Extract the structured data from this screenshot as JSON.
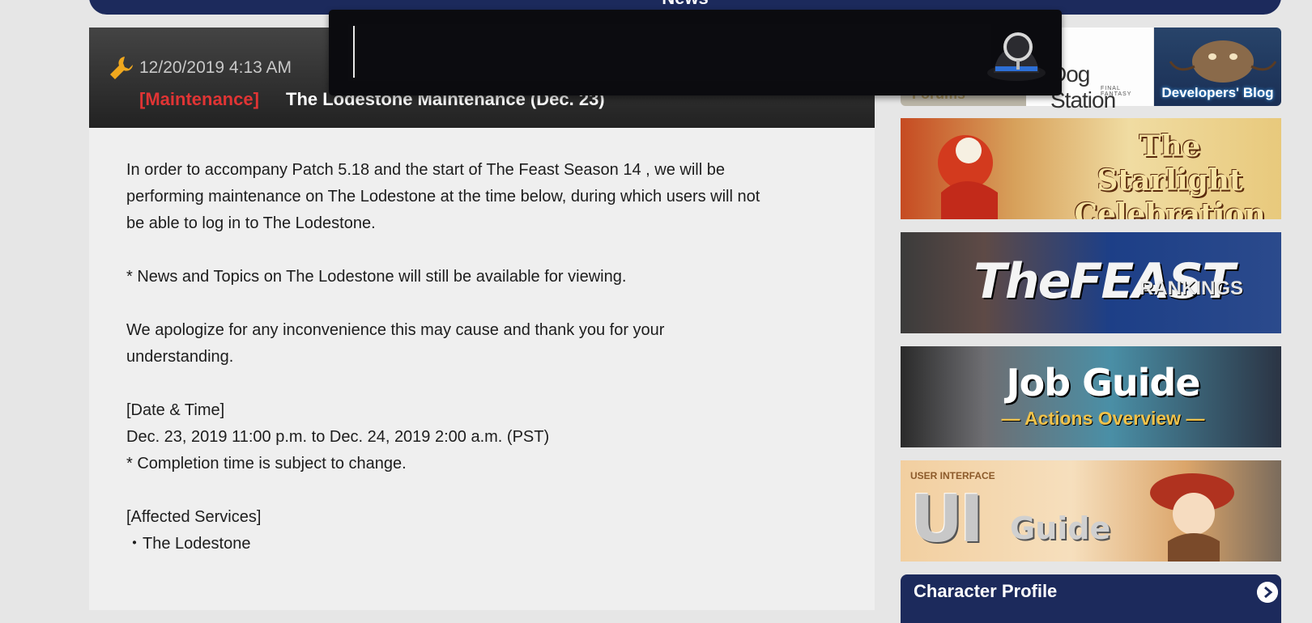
{
  "header": {
    "section_title": "News"
  },
  "article": {
    "date": "12/20/2019 4:13 AM",
    "tag": "[Maintenance]",
    "title": "The Lodestone Maintenance (Dec. 23)",
    "paragraphs": [
      [
        "In order to accompany Patch 5.18 and the start of The Feast Season 14 , we will be",
        "performing maintenance on The Lodestone at the time below, during which users will not",
        "be able to log in to The Lodestone."
      ],
      [
        "* News and Topics on The Lodestone will still be available for viewing."
      ],
      [
        "We apologize for any inconvenience this may cause and thank you for your",
        "understanding."
      ],
      [
        "[Date & Time]",
        "Dec. 23, 2019 11:00 p.m. to Dec. 24, 2019 2:00 a.m. (PST)",
        "* Completion time is subject to change."
      ],
      [
        "[Affected Services]",
        "・The Lodestone"
      ]
    ]
  },
  "search": {
    "value": "",
    "placeholder": ""
  },
  "sidebar": {
    "forums_label": "Forums",
    "lodestation_label": "Dog Station",
    "lodestation_sub": "FINAL FANTASY",
    "devblog_label": "Developers' Blog",
    "starlight_line1": "The Starlight",
    "starlight_line2": "Celebration",
    "feast_title": "TheFEAST",
    "feast_sub": "RANKINGS",
    "jobguide_title": "Job Guide",
    "jobguide_sub": "— Actions Overview —",
    "uiguide_label": "USER INTERFACE",
    "uiguide_big": "UI",
    "uiguide_small": "Guide",
    "character_profile_title": "Character Profile"
  },
  "colors": {
    "accent_navy": "#1c2a5c",
    "maintenance_red": "#e03434",
    "page_bg": "#e6e6e6"
  },
  "icons": [
    "wrench-icon",
    "search-icon",
    "chevron-right-icon"
  ]
}
